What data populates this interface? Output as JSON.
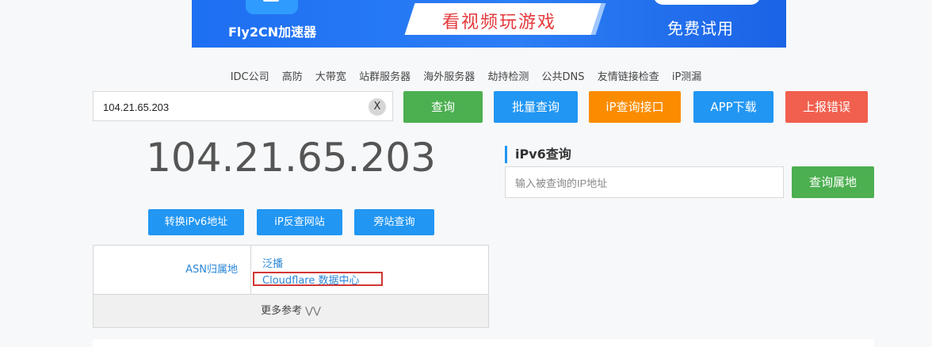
{
  "banner": {
    "brand": "Fly2CN加速器",
    "slogan": "看视频玩游戏",
    "cta": "免费试用"
  },
  "nav": [
    "IDC公司",
    "高防",
    "大带宽",
    "站群服务器",
    "海外服务器",
    "劫持检测",
    "公共DNS",
    "友情链接检查",
    "iP测漏"
  ],
  "search": {
    "value": "104.21.65.203",
    "clear_label": "X",
    "query_label": "查询",
    "batch_label": "批量查询",
    "api_label": "iP查询接口",
    "app_label": "APP下载",
    "report_label": "上报错误"
  },
  "result": {
    "ip": "104.21.65.203",
    "actions": {
      "to_ipv6": "转换iPv6地址",
      "reverse": "iP反查网站",
      "side": "旁站查询"
    },
    "asn_label": "ASN归属地",
    "asn_value1": "泛播",
    "asn_value2": "Cloudflare 数据中心",
    "more_label": "更多参考",
    "more_icon": "double-chevron-down-icon"
  },
  "ipv6": {
    "title": "iPv6查询",
    "placeholder": "输入被查询的IP地址",
    "button_label": "查询属地"
  },
  "colors": {
    "green": "#4caf50",
    "blue": "#2196f3",
    "orange": "#fb8c00",
    "red": "#f15f4e",
    "link": "#2b86d6",
    "highlight": "#d23636"
  }
}
